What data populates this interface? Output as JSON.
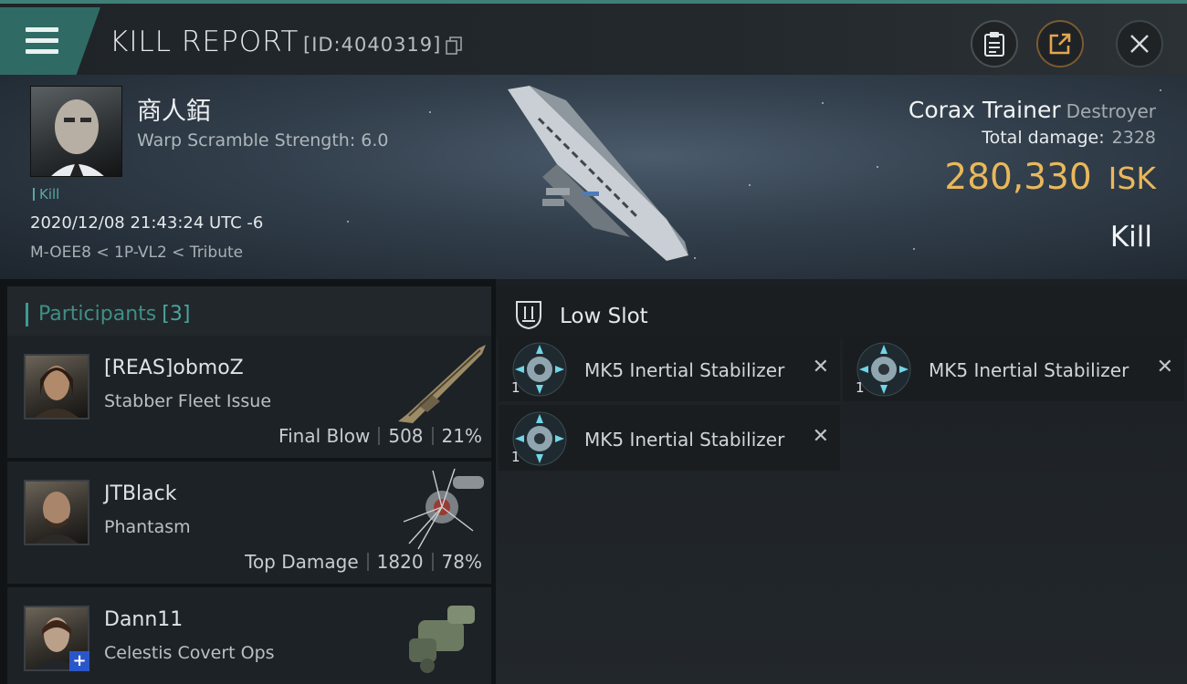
{
  "header": {
    "title": "KILL REPORT",
    "report_id": "[ID:4040319]",
    "buttons": {
      "clipboard_icon": "clipboard-icon",
      "share_icon": "share-icon",
      "close_icon": "close-icon"
    }
  },
  "victim": {
    "name": "商人銆",
    "warp_scramble": "Warp Scramble Strength: 6.0",
    "kill_tag": "Kill",
    "date": "2020/12/08 21:43:24 UTC -6",
    "location": "M-OEE8 < 1P-VL2 < Tribute",
    "ship_name": "Corax Trainer",
    "ship_class": "Destroyer",
    "total_damage_label": "Total damage:",
    "total_damage_value": "2328",
    "isk_value": "280,330",
    "isk_unit": "ISK",
    "result": "Kill"
  },
  "participants": {
    "title": "Participants",
    "count": "[3]",
    "list": [
      {
        "name": "[REAS]obmoZ",
        "ship": "Stabber Fleet Issue",
        "stat_label": "Final Blow",
        "damage": "508",
        "percent": "21%"
      },
      {
        "name": "JTBlack",
        "ship": "Phantasm",
        "stat_label": "Top Damage",
        "damage": "1820",
        "percent": "78%"
      },
      {
        "name": "Dann11",
        "ship": "Celestis Covert Ops"
      }
    ]
  },
  "low_slot": {
    "title": "Low Slot",
    "items": [
      {
        "name": "MK5 Inertial Stabilizer",
        "qty": "1"
      },
      {
        "name": "MK5 Inertial Stabilizer",
        "qty": "1"
      },
      {
        "name": "MK5 Inertial Stabilizer",
        "qty": "1"
      }
    ]
  }
}
